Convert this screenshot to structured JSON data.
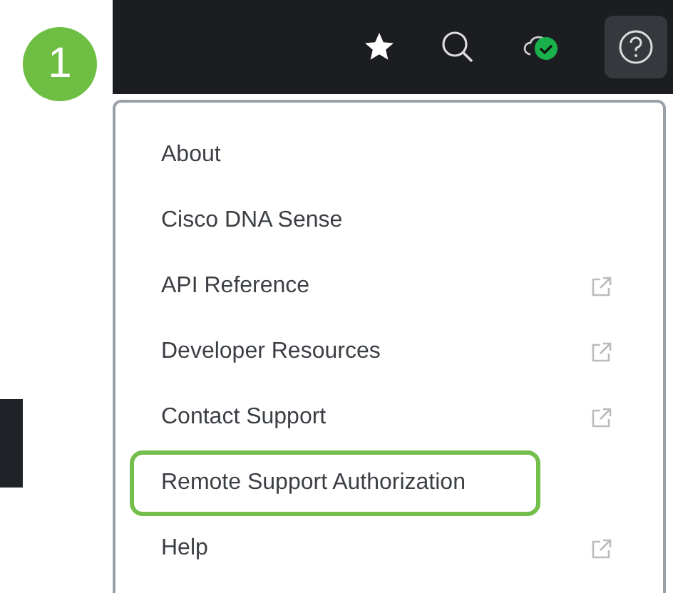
{
  "step_badge": "1",
  "toolbar": {
    "help_active": true
  },
  "menu": {
    "items": [
      {
        "label": "About",
        "external": false,
        "highlighted": false
      },
      {
        "label": "Cisco DNA Sense",
        "external": false,
        "highlighted": false
      },
      {
        "label": "API Reference",
        "external": true,
        "highlighted": false
      },
      {
        "label": "Developer Resources",
        "external": true,
        "highlighted": false
      },
      {
        "label": "Contact Support",
        "external": true,
        "highlighted": false
      },
      {
        "label": "Remote Support Authorization",
        "external": false,
        "highlighted": true
      },
      {
        "label": "Help",
        "external": true,
        "highlighted": false
      }
    ]
  }
}
